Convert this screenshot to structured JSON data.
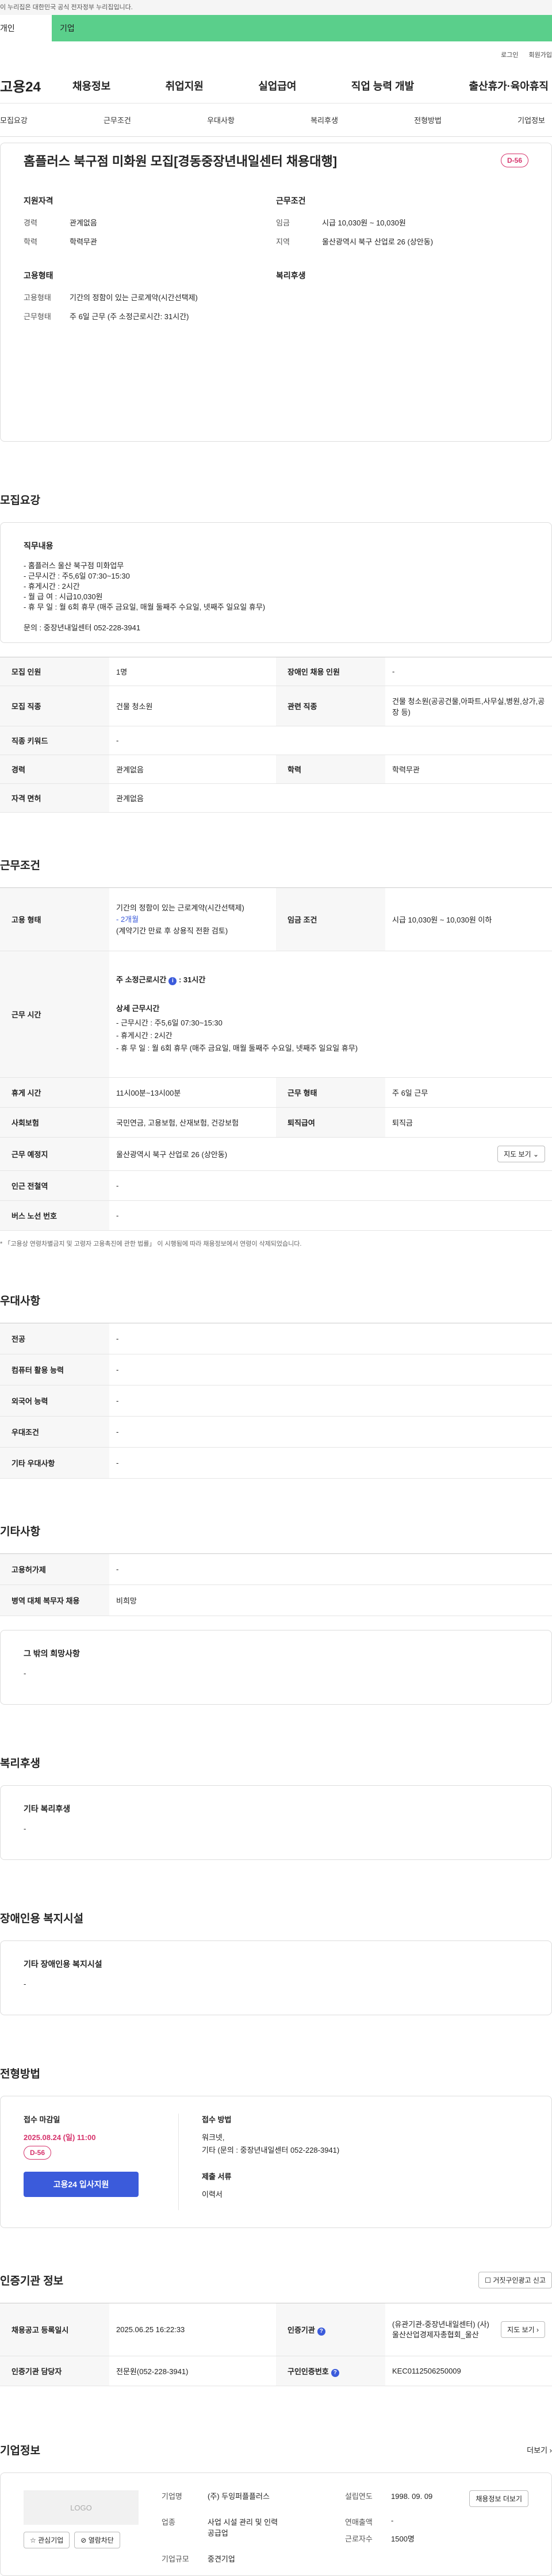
{
  "gov_banner": "이 누리집은 대한민국 공식 전자정부 누리집입니다.",
  "top_tabs": [
    "개인",
    "기업"
  ],
  "util": [
    "로그인",
    "회원가입"
  ],
  "logo": "고용24",
  "gnb": [
    "채용정보",
    "취업지원",
    "실업급여",
    "직업 능력 개발",
    "출산휴가·육아휴직"
  ],
  "anchor": [
    "모집요강",
    "근무조건",
    "우대사항",
    "복리후생",
    "전형방법",
    "기업정보"
  ],
  "title": "홈플러스 북구점 미화원 모집[경동중장년내일센터 채용대행]",
  "dday": "D-56",
  "summary": {
    "qual_title": "지원자격",
    "career_k": "경력",
    "career_v": "관계없음",
    "edu_k": "학력",
    "edu_v": "학력무관",
    "cond_title": "근무조건",
    "wage_k": "임금",
    "wage_v": "시급 10,030원 ~ 10,030원",
    "region_k": "지역",
    "region_v": "울산광역시 북구 산업로 26 (상안동)",
    "emp_title": "고용형태",
    "emptype_k": "고용형태",
    "emptype_v": "기간의 정함이 있는 근로계약(시간선택제)",
    "worktype_k": "근무형태",
    "worktype_v": "주 6일 근무 (주 소정근로시간: 31시간)",
    "welfare_title": "복리후생"
  },
  "recruit": {
    "heading": "모집요강",
    "job_title": "직무내용",
    "lines": [
      "- 홈플러스 울산 북구점 미화업무",
      "- 근무시간 : 주5,6일 07:30~15:30",
      "- 휴게시간 : 2시간",
      "- 월 급 여 : 시급10,030원",
      "- 휴 무 일 : 월 6회 휴무 (매주 금요일, 매월 둘째주 수요일, 넷째주 일요일 휴무)",
      "",
      "문의 : 중장년내일센터 052-228-3941"
    ],
    "rows": [
      [
        "모집 인원",
        "1명",
        "장애인 채용 인원",
        "-"
      ],
      [
        "모집 직종",
        "건물 청소원",
        "관련 직종",
        "건물 청소원(공공건물,아파트,사무실,병원,상가,공장 등)"
      ],
      [
        "직종 키워드",
        "-",
        "",
        ""
      ],
      [
        "경력",
        "관계없음",
        "학력",
        "학력무관"
      ],
      [
        "자격 면허",
        "관계없음",
        "",
        ""
      ]
    ]
  },
  "work": {
    "heading": "근무조건",
    "emp_k": "고용 형태",
    "emp_v1": "기간의 정함이 있는 근로계약(시간선택제)",
    "emp_v2": "- 2개월",
    "emp_v3": "(계약기간 만료 후 상용직 전환 검토)",
    "wage_k": "임금 조건",
    "wage_v": "시급 10,030원 ~ 10,030원 이하",
    "time_k": "근무 시간",
    "time_lines": [
      "주 소정근로시간",
      "31시간",
      "상세 근무시간",
      "- 근무시간 : 주5,6일 07:30~15:30",
      "- 휴게시간 : 2시간",
      "- 휴 무 일 : 월 6회 휴무 (매주 금요일, 매월 둘째주 수요일, 넷째주 일요일 휴무)"
    ],
    "rest_k": "휴게 시간",
    "rest_v": "11시00분~13시00분",
    "form_k": "근무 형태",
    "form_v": "주 6일 근무",
    "ins_k": "사회보험",
    "ins_v": "국민연금, 고용보험, 산재보험, 건강보험",
    "sev_k": "퇴직급여",
    "sev_v": "퇴직금",
    "place_k": "근무 예정지",
    "place_v": "울산광역시 북구 산업로 26 (상안동)",
    "map_btn": "지도 보기",
    "station_k": "인근 전철역",
    "station_v": "-",
    "bus_k": "버스 노선 번호",
    "bus_v": "-",
    "note": "* 「고용상 연령차별금지 및 고령자 고용촉진에 관한 법률」 이 시행됨에 따라 채용정보에서 연령이 삭제되었습니다."
  },
  "pref": {
    "heading": "우대사항",
    "rows": [
      [
        "전공",
        "-"
      ],
      [
        "컴퓨터 활용 능력",
        "-"
      ],
      [
        "외국어 능력",
        "-"
      ],
      [
        "우대조건",
        "-"
      ],
      [
        "기타 우대사항",
        "-"
      ]
    ]
  },
  "etc": {
    "heading": "기타사항",
    "rows": [
      [
        "고용허가제",
        "-"
      ],
      [
        "병역 대체 복무자 채용",
        "비희망"
      ]
    ],
    "box_title": "그 밖의 희망사항",
    "box_value": "-"
  },
  "welfare": {
    "heading": "복리후생",
    "box_title": "기타 복리후생",
    "box_value": "-"
  },
  "disab": {
    "heading": "장애인용 복지시설",
    "box_title": "기타 장애인용 복지시설",
    "box_value": "-"
  },
  "apply": {
    "heading": "전형방법",
    "deadline_label": "접수 마감일",
    "deadline": "2025.08.24 (일) 11:00",
    "dday": "D-56",
    "button": "고용24 입사지원",
    "method_label": "접수 방법",
    "method_1": "워크넷,",
    "method_2": "기타 (문의 : 중장년내일센터 052-228-3941)",
    "doc_label": "제출 서류",
    "doc_value": "이력서"
  },
  "agency": {
    "heading": "인증기관 정보",
    "report_btn": "거짓구인광고 신고",
    "reg_k": "채용공고 등록일시",
    "reg_v": "2025.06.25 16:22:33",
    "org_k": "인증기관",
    "org_v": "(유관기관-중장년내일센터) (사)울산산업경제자총협회_울산",
    "map_btn": "지도 보기",
    "mgr_k": "인증기관 담당자",
    "mgr_v": "전문원(052-228-3941)",
    "no_k": "구인인증번호",
    "no_v": "KEC0112506250009"
  },
  "company": {
    "heading": "기업정보",
    "more": "더보기",
    "logo_text": "LOGO",
    "fav_btn": "관심기업",
    "block_btn": "열람차단",
    "name_k": "기업명",
    "name_v": "(주) 두잉퍼플플러스",
    "est_k": "설립연도",
    "est_v": "1998. 09. 09",
    "info_btn": "채용정보 더보기",
    "ind_k": "업종",
    "ind_v": "사업 시설 관리 및 인력 공급업",
    "sales_k": "연매출액",
    "sales_v": "-",
    "emp_k": "근로자수",
    "emp_v": "1500명",
    "size_k": "기업규모",
    "size_v": "중견기업"
  }
}
